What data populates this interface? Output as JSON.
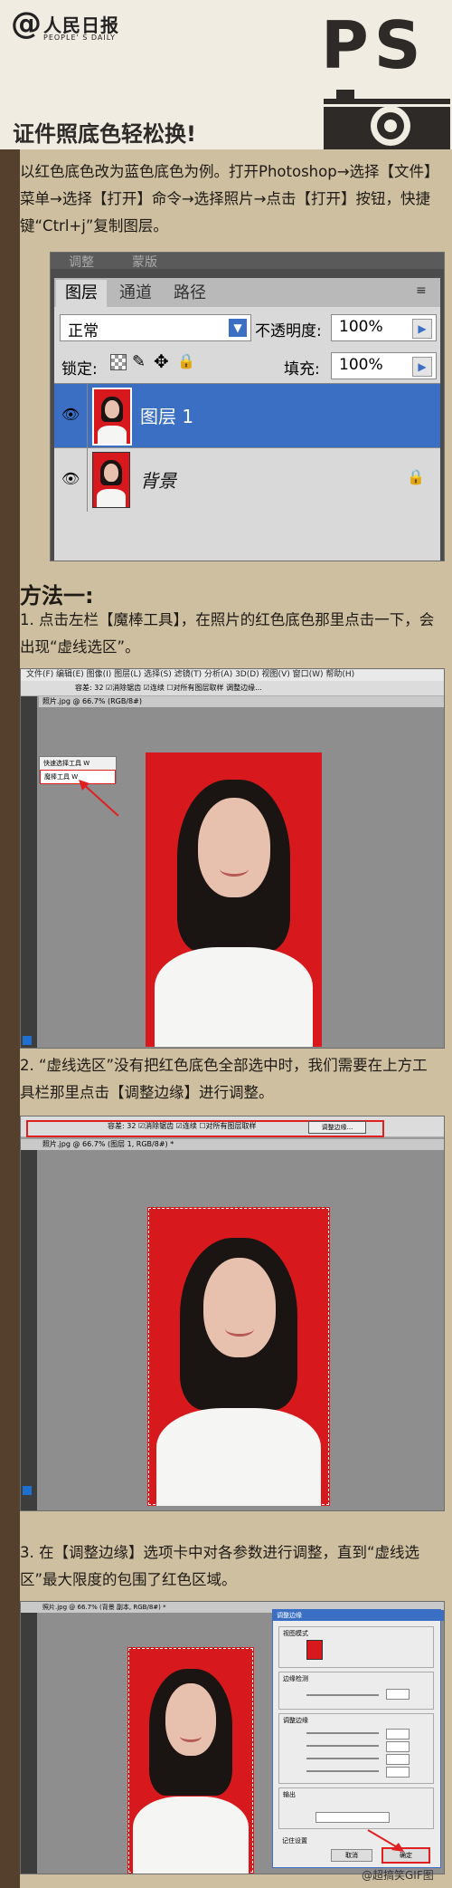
{
  "header": {
    "logo_at": "@",
    "logo_cn": "人民日报",
    "logo_en": "PEOPLE' S DAILY",
    "ps_letters": "PS",
    "title": "证件照底色轻松换!"
  },
  "intro": {
    "text": "以红色底色改为蓝色底色为例。打开Photoshop→选择【文件】菜单→选择【打开】命令→选择照片→点击【打开】按钮，快捷键“Ctrl+j”复制图层。"
  },
  "layers_panel": {
    "top_tabs": [
      "调整",
      "蒙版"
    ],
    "tabs": [
      "图层",
      "通道",
      "路径"
    ],
    "blend_mode": "正常",
    "opacity_label": "不透明度:",
    "opacity_value": "100%",
    "lock_label": "锁定:",
    "fill_label": "填充:",
    "fill_value": "100%",
    "layers": [
      {
        "name": "图层 1",
        "selected": true
      },
      {
        "name": "背景",
        "locked": true
      }
    ]
  },
  "method1": {
    "heading": "方法一:",
    "step1": "1. 点击左栏【魔棒工具】，在照片的红色底色那里点击一下，会出现“虚线选区”。",
    "step2": "2. “虚线选区”没有把红色底色全部选中时，我们需要在上方工具栏那里点击【调整边缘】进行调整。",
    "step3": "3. 在【调整边缘】选项卡中对各参数进行调整，直到“虚线选区”最大限度的包围了红色区域。"
  },
  "screenshot1": {
    "menu": "文件(F)  编辑(E)  图像(I)  图层(L)  选择(S)  滤镜(T)  分析(A)  3D(D)  视图(V)  窗口(W)  帮助(H)",
    "options": "容差: 32   ☑消除锯齿  ☑连续  ☐对所有图层取样   调整边缘...",
    "doc_tab": "照片.jpg @ 66.7% (RGB/8#)",
    "popup_items": [
      "快速选择工具   W",
      "魔棒工具   W"
    ]
  },
  "screenshot2": {
    "options": "容差: 32  ☑消除锯齿  ☑连续  ☐对所有图层取样",
    "refine_button": "调整边缘...",
    "doc_tab": "照片.jpg @ 66.7% (图层 1, RGB/8#) *"
  },
  "screenshot3": {
    "doc_tab": "照片.jpg @ 66.7% (背景 副本, RGB/8#) *",
    "dialog_title": "调整边缘",
    "sections": [
      "视图模式",
      "边缘检测",
      "调整边缘",
      "输出"
    ],
    "buttons": [
      "取消",
      "确定"
    ],
    "check": "记住设置"
  },
  "watermark": "@超搞笑GIF图",
  "colors": {
    "page_bg": "#c9bda2",
    "stripe": "#55402e",
    "header_bg": "#f1ece2",
    "ps_blue_layer": "#3a6fc4",
    "photo_red": "#d7191d",
    "highlight_red": "#e02020"
  }
}
